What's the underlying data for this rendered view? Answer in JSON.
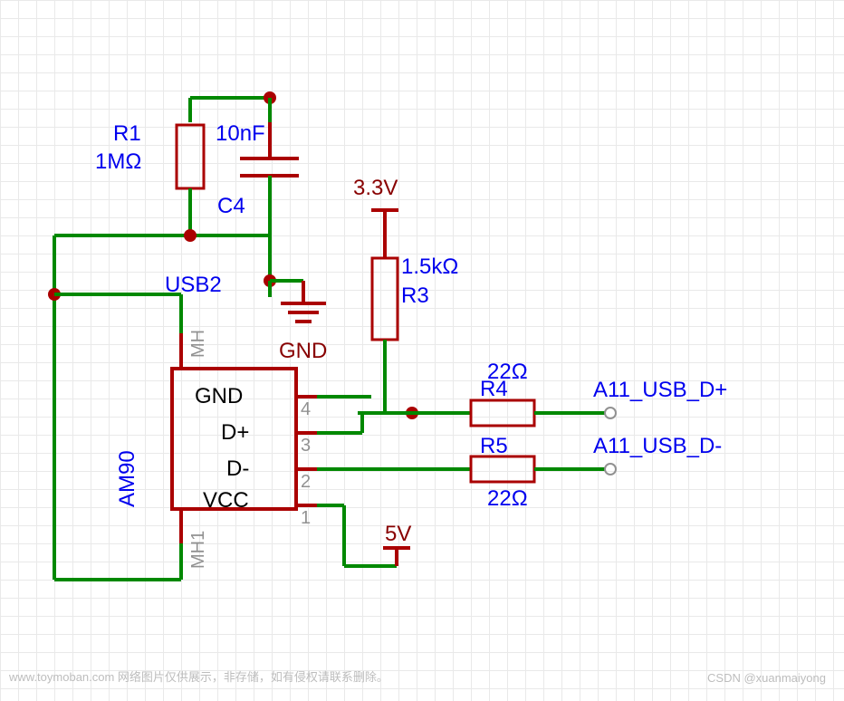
{
  "components": {
    "R1": {
      "ref": "R1",
      "value": "1MΩ"
    },
    "C4": {
      "ref": "C4",
      "value": "10nF"
    },
    "R3": {
      "ref": "R3",
      "value": "1.5kΩ"
    },
    "R4": {
      "ref": "R4",
      "value": "22Ω"
    },
    "R5": {
      "ref": "R5",
      "value": "22Ω"
    },
    "U_usb": {
      "ref": "USB2",
      "value": "AM90"
    }
  },
  "power": {
    "v33": "3.3V",
    "v5": "5V",
    "gnd": "GND"
  },
  "pins": {
    "gnd": "GND",
    "dp": "D+",
    "dm": "D-",
    "vcc": "VCC",
    "mh": "MH",
    "mh1": "MH1",
    "p1": "1",
    "p2": "2",
    "p3": "3",
    "p4": "4"
  },
  "nets": {
    "usb_dp": "A11_USB_D+",
    "usb_dm": "A11_USB_D-"
  },
  "footer": {
    "left": "www.toymoban.com 网络图片仅供展示，非存储，如有侵权请联系删除。",
    "right": "CSDN @xuanmaiyong"
  }
}
